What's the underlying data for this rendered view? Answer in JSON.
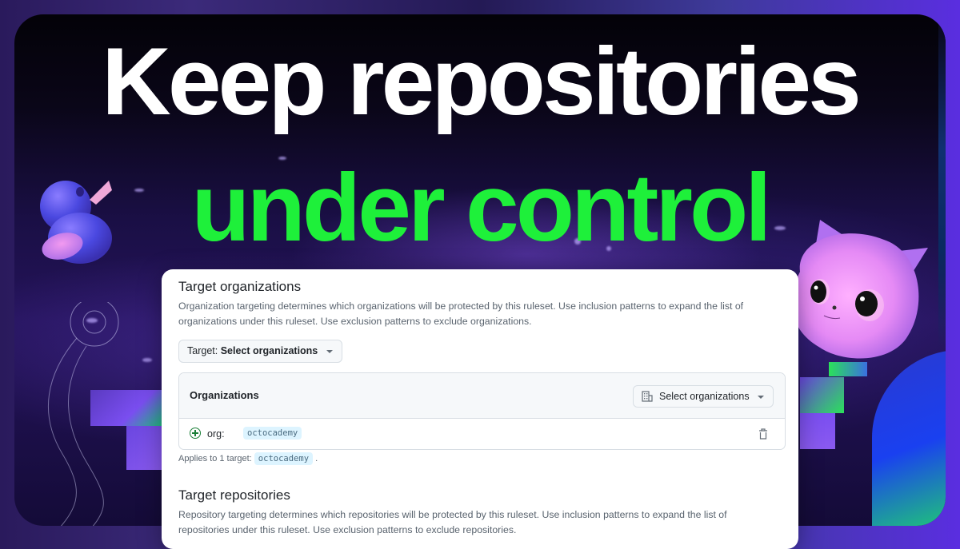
{
  "headline": {
    "line1": "Keep repositories",
    "line2": "under control",
    "line1_color": "#ffffff",
    "line2_color": "#1ef03a"
  },
  "card": {
    "target_organizations": {
      "title": "Target organizations",
      "description": "Organization targeting determines which organizations will be protected by this ruleset. Use inclusion patterns to expand the list of organizations under this ruleset. Use exclusion patterns to exclude organizations.",
      "target_button": {
        "prefix": "Target:",
        "value": "Select organizations",
        "icon": "caret-down-icon"
      },
      "organizations_box": {
        "header": "Organizations",
        "select_button": {
          "label": "Select organizations",
          "icon": "organization-icon",
          "caret": "caret-down-icon"
        },
        "rows": [
          {
            "icon": "plus-circle-icon",
            "label": "org:",
            "value": "octocademy",
            "action_icon": "trash-icon"
          }
        ]
      },
      "applies": {
        "prefix": "Applies to 1 target:",
        "value": "octocademy",
        "suffix": "."
      }
    },
    "target_repositories": {
      "title": "Target repositories",
      "description": "Repository targeting determines which repositories will be protected by this ruleset. Use inclusion patterns to expand the list of repositories under this ruleset. Use exclusion patterns to exclude repositories."
    }
  },
  "illustrations": {
    "left": "duck-mascot",
    "right": "octocat-head-mascot"
  }
}
